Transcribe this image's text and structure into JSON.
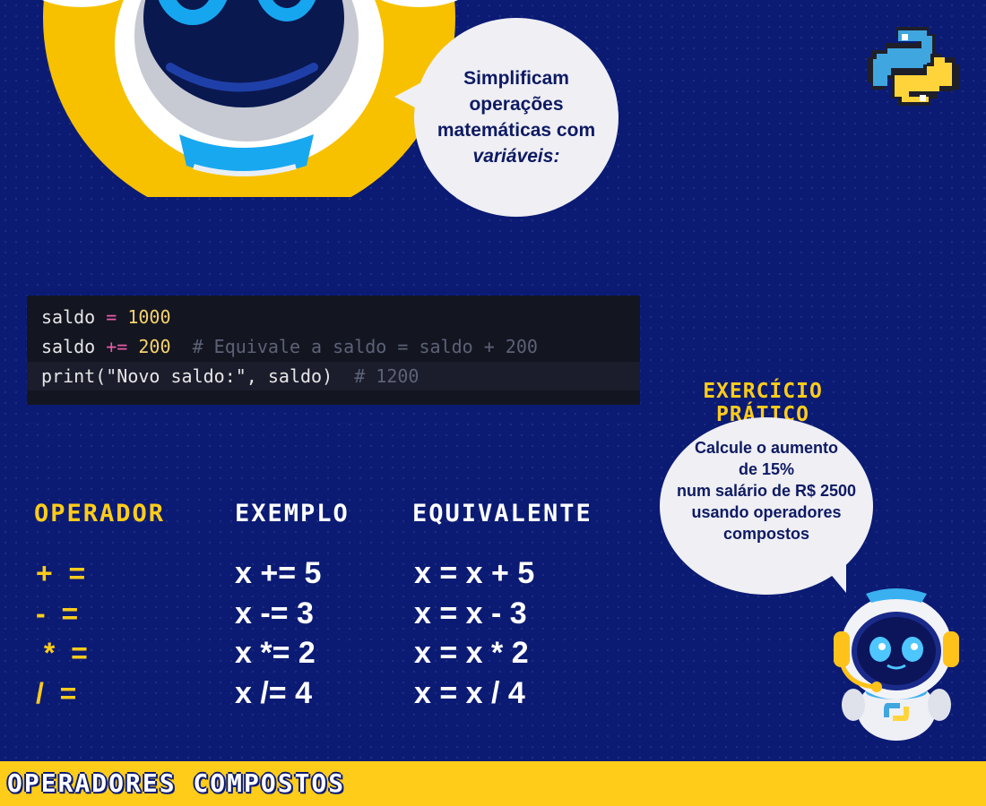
{
  "bubble_intro": {
    "line1": "Simplificam",
    "line2": "operações",
    "line3": "matemáticas com",
    "line4": "variáveis:"
  },
  "code": {
    "lines": [
      {
        "tokens": [
          {
            "text": "saldo",
            "kind": "plain"
          },
          {
            "text": " = ",
            "kind": "op"
          },
          {
            "text": "1000",
            "kind": "num"
          }
        ]
      },
      {
        "tokens": [
          {
            "text": "saldo",
            "kind": "plain"
          },
          {
            "text": " += ",
            "kind": "op"
          },
          {
            "text": "200",
            "kind": "num"
          },
          {
            "text": "  # Equivale a saldo = saldo + 200",
            "kind": "comment"
          }
        ]
      },
      {
        "tokens": [
          {
            "text": "print(",
            "kind": "plain"
          },
          {
            "text": "\"Novo saldo:\"",
            "kind": "str"
          },
          {
            "text": ", saldo)",
            "kind": "plain"
          },
          {
            "text": "  # 1200",
            "kind": "comment"
          }
        ]
      }
    ]
  },
  "exercise": {
    "title_line1": "EXERCÍCIO",
    "title_line2": "PRÁTICO",
    "line1": "Calcule o aumento",
    "line2": "de 15%",
    "line3": "num salário de R$ 2500",
    "line4": "usando operadores",
    "line5": "compostos"
  },
  "table": {
    "headers": {
      "operator": "OPERADOR",
      "example": "EXEMPLO",
      "equivalent": "EQUIVALENTE"
    },
    "rows": [
      {
        "operator": "+  =",
        "example": "x += 5",
        "equivalent": "x = x + 5"
      },
      {
        "operator": "-  =",
        "example": "x -= 3",
        "equivalent": "x = x - 3"
      },
      {
        "operator": " *  =",
        "example": "x *= 2",
        "equivalent": "x = x * 2"
      },
      {
        "operator": "/  =",
        "example": "x /= 4",
        "equivalent": "x = x / 4"
      }
    ]
  },
  "footer": {
    "title": "OPERADORES COMPOSTOS"
  },
  "icons": {
    "python_logo": "python-logo-icon",
    "robot_large": "robot-mascot-icon",
    "robot_small": "robot-mascot-small-icon"
  },
  "colors": {
    "background": "#0b1b74",
    "accent_yellow": "#ffcc1a",
    "bubble": "#efeff4",
    "text_dark": "#0e1a63",
    "python_blue": "#3fa6e0",
    "python_yellow": "#ffd43b"
  }
}
